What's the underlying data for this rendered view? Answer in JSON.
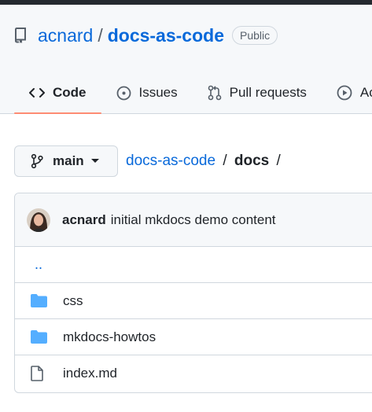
{
  "repo": {
    "owner": "acnard",
    "separator": "/",
    "name": "docs-as-code",
    "visibility": "Public"
  },
  "tabs": [
    {
      "label": "Code",
      "icon": "code-icon",
      "active": true
    },
    {
      "label": "Issues",
      "icon": "issue-opened-icon",
      "active": false
    },
    {
      "label": "Pull requests",
      "icon": "git-pull-request-icon",
      "active": false
    },
    {
      "label": "Ac",
      "icon": "play-icon",
      "active": false
    }
  ],
  "branch": {
    "name": "main",
    "icon": "git-branch-icon"
  },
  "breadcrumb": {
    "root": "docs-as-code",
    "separator": "/",
    "current": "docs",
    "trailing": "/"
  },
  "latest_commit": {
    "author": "acnard",
    "message": "initial mkdocs demo content"
  },
  "files": {
    "parent": "..",
    "items": [
      {
        "name": "css",
        "type": "folder"
      },
      {
        "name": "mkdocs-howtos",
        "type": "folder"
      },
      {
        "name": "index.md",
        "type": "file"
      }
    ]
  },
  "colors": {
    "link": "#0969da",
    "folder": "#54aeff",
    "active_tab_underline": "#fd8c73",
    "border": "#d0d7de"
  }
}
